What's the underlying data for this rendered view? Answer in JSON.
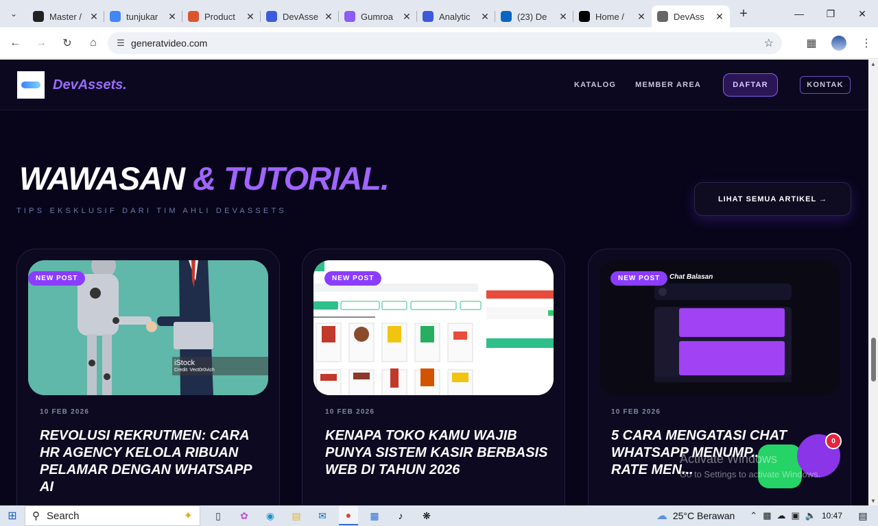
{
  "browser": {
    "tabs": [
      {
        "title": "Master /",
        "favicon": "github-icon",
        "color": "#222"
      },
      {
        "title": "tunjukar",
        "favicon": "google-icon",
        "color": "#4285f4"
      },
      {
        "title": "Product",
        "favicon": "producthunt-icon",
        "color": "#da552f"
      },
      {
        "title": "DevAsse",
        "favicon": "shield-icon",
        "color": "#3b5bdb"
      },
      {
        "title": "Gumroa",
        "favicon": "gumroad-icon",
        "color": "#8b5cf6"
      },
      {
        "title": "Analytic",
        "favicon": "shield-icon",
        "color": "#3b5bdb"
      },
      {
        "title": "(23) De",
        "favicon": "linkedin-icon",
        "color": "#0a66c2"
      },
      {
        "title": "Home /",
        "favicon": "x-icon",
        "color": "#000"
      },
      {
        "title": "DevAss",
        "favicon": "globe-icon",
        "color": "#666",
        "active": true
      }
    ],
    "url": "generatvideo.com"
  },
  "site": {
    "brand": "DevAssets.",
    "nav": {
      "katalog": "KATALOG",
      "member": "MEMBER AREA",
      "daftar": "DAFTAR",
      "kontak": "KONTAK"
    },
    "hero_main": "WAWASAN",
    "hero_accent": "& TUTORIAL.",
    "subtitle": "TIPS EKSKLUSIF DARI TIM AHLI DEVASSETS",
    "all_articles": "LIHAT SEMUA ARTIKEL →",
    "cards": [
      {
        "badge": "NEW POST",
        "date": "10 FEB 2026",
        "title": "REVOLUSI REKRUTMEN: CARA HR AGENCY KELOLA RIBUAN PELAMAR DENGAN WHATSAPP AI",
        "img_credit": "iStock",
        "img_credit2": "Credit: Vect0r0vich"
      },
      {
        "badge": "NEW POST",
        "date": "10 FEB 2026",
        "title": "KENAPA TOKO KAMU WAJIB PUNYA SISTEM KASIR BERBASIS WEB DI TAHUN 2026"
      },
      {
        "badge": "NEW POST",
        "date": "10 FEB 2026",
        "title": "5 CARA MENGATASI CHAT WHATSAPP MENUMP... CLOSING RATE MEN...",
        "img_heading": "Chat Balasan"
      }
    ],
    "chat_badge_count": "0",
    "activate_line1": "Activate Windows",
    "activate_line2": "Go to Settings to activate Windows."
  },
  "taskbar": {
    "search_placeholder": "Search",
    "weather": "25°C  Berawan",
    "time": "10:47"
  }
}
